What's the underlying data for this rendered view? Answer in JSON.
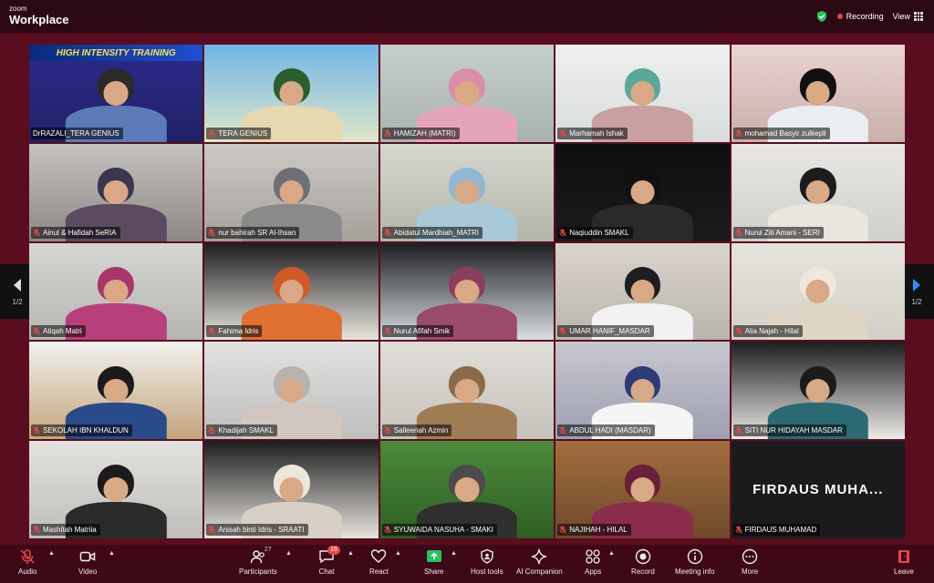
{
  "app": {
    "brand_small": "zoom",
    "brand_big": "Workplace"
  },
  "topbar": {
    "recording": "Recording",
    "view": "View"
  },
  "pager": {
    "left_page": "1/2",
    "right_page": "1/2"
  },
  "banner": "HIGH INTENSITY TRAINING",
  "participants": [
    {
      "name": "DrRAZALI_TERA GENIUS",
      "muted": false
    },
    {
      "name": "TERA GENIUS",
      "muted": true
    },
    {
      "name": "HAMIZAH (MATRI)",
      "muted": true
    },
    {
      "name": "Marhamah Ishak",
      "muted": true
    },
    {
      "name": "mohamad Basyir zulkepli",
      "muted": true
    },
    {
      "name": "Ainul & Hafidah SeRIA",
      "muted": true
    },
    {
      "name": "nur bahirah SR Al-Ihsan",
      "muted": true
    },
    {
      "name": "Abidatul Mardhiah_MATRI",
      "muted": true
    },
    {
      "name": "Naqiuddin SMAKL",
      "muted": true
    },
    {
      "name": "Nurul Ziti Amani - SERI",
      "muted": true
    },
    {
      "name": "Atiqah Matri",
      "muted": true
    },
    {
      "name": "Fahima Idris",
      "muted": true
    },
    {
      "name": "Nurul Afifah Smik",
      "muted": true
    },
    {
      "name": "UMAR HANIF_MASDAR",
      "muted": true
    },
    {
      "name": "Alia Najah - Hilal",
      "muted": true
    },
    {
      "name": "SEKOLAH IBN KHALDUN",
      "muted": true
    },
    {
      "name": "Khadijah SMAKL",
      "muted": true
    },
    {
      "name": "Salleenah Azmin",
      "muted": true
    },
    {
      "name": "ABDUL HADI (MASDAR)",
      "muted": true
    },
    {
      "name": "SITI NUR HIDAYAH MASDAR",
      "muted": true
    },
    {
      "name": "Mashitah Matriia",
      "muted": true
    },
    {
      "name": "Anisah binti Idris - SRAATI",
      "muted": true
    },
    {
      "name": "SYUWAIDA NASUHA - SMAKI",
      "muted": true
    },
    {
      "name": "NAJIHAH - HILAL",
      "muted": true
    },
    {
      "name": "FIRDAUS MUHAMAD",
      "muted": true
    }
  ],
  "video_off_name": "FIRDAUS  MUHA...",
  "toolbar": {
    "audio": "Audio",
    "video": "Video",
    "participants": "Participants",
    "participants_count": "27",
    "chat": "Chat",
    "chat_badge": "16",
    "react": "React",
    "share": "Share",
    "host_tools": "Host tools",
    "ai_companion": "AI Companion",
    "apps": "Apps",
    "record": "Record",
    "meeting_info": "Meeting info",
    "more": "More",
    "leave": "Leave"
  },
  "colors": {
    "background": "#5a0d1e",
    "topbar": "#2b0a14",
    "toolbar": "#3e0816",
    "active_speaker": "#35c98a",
    "share_green": "#22c55e",
    "muted_red": "#e5484d"
  }
}
